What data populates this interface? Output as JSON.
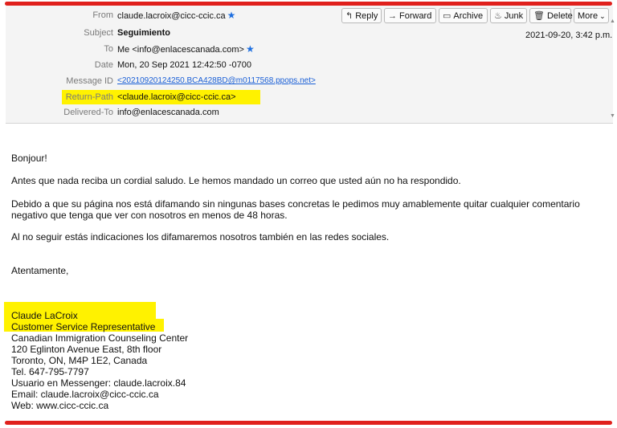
{
  "header": {
    "from": {
      "label": "From",
      "value": "claude.lacroix@cicc-ccic.ca"
    },
    "subject": {
      "label": "Subject",
      "value": "Seguimiento"
    },
    "to": {
      "label": "To",
      "value": "Me <info@enlacescanada.com>"
    },
    "date": {
      "label": "Date",
      "value": "Mon, 20 Sep 2021 12:42:50 -0700"
    },
    "message_id": {
      "label": "Message ID",
      "value": "<20210920124250.BCA428BD@m0117568.ppops.net>"
    },
    "return_path": {
      "label": "Return-Path",
      "value": "<claude.lacroix@cicc-ccic.ca>"
    },
    "delivered_to": {
      "label": "Delivered-To",
      "value": "info@enlacescanada.com"
    },
    "received_date": "2021-09-20, 3:42 p.m.",
    "highlight_color": "#fff200"
  },
  "toolbar": {
    "reply": "Reply",
    "forward": "Forward",
    "archive": "Archive",
    "junk": "Junk",
    "delete": "Delete",
    "more": "More"
  },
  "body": {
    "greeting": "Bonjour!",
    "p1": "Antes que nada reciba un cordial saludo.  Le hemos mandado un correo que usted aún no ha respondido.",
    "p2": " Debido a que su página nos está difamando sin ningunas bases concretas le pedimos muy amablemente quitar cualquier comentario negativo que tenga que ver con nosotros en menos de 48 horas.",
    "p3": "Al no seguir estás indicaciones los difamaremos   nosotros también en las redes sociales.",
    "closing": "Atentamente,"
  },
  "signature": {
    "name": "Claude LaCroix",
    "title": "Customer Service Representative",
    "company": "Canadian Immigration Counseling Center",
    "address1": "120 Eglinton Avenue East, 8th floor",
    "address2": "Toronto, ON, M4P 1E2, Canada",
    "tel": "Tel. 647-795-7797",
    "messenger": "Usuario en Messenger: claude.lacroix.84",
    "email": "Email: claude.lacroix@cicc-ccic.ca",
    "web": "Web:  www.cicc-ccic.ca"
  },
  "colors": {
    "accent_red": "#e0201c",
    "link_blue": "#1a5fd6",
    "star_blue": "#1e6fe0"
  }
}
